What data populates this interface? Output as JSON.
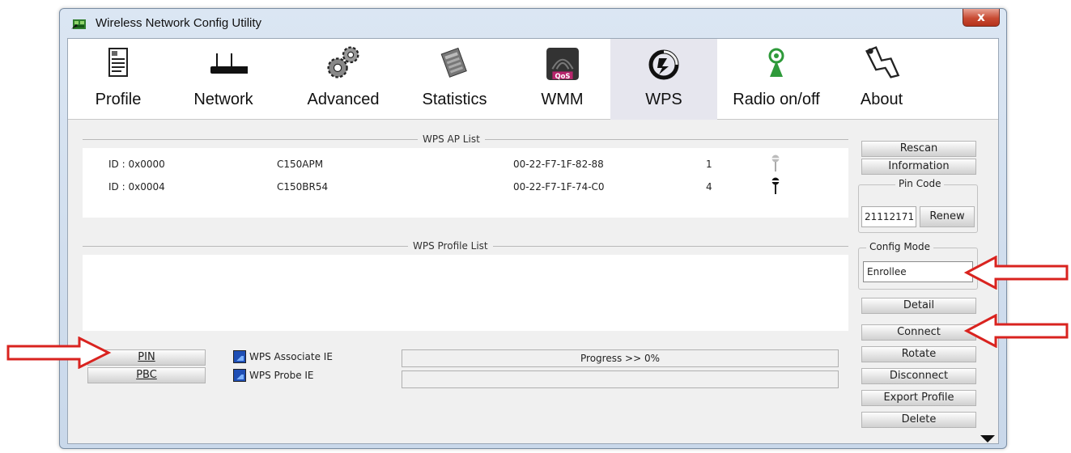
{
  "window": {
    "title": "Wireless Network Config Utility",
    "close_glyph": "x"
  },
  "toolbar": {
    "items": [
      {
        "label": "Profile",
        "icon": "profile-icon"
      },
      {
        "label": "Network",
        "icon": "network-icon"
      },
      {
        "label": "Advanced",
        "icon": "advanced-gears-icon"
      },
      {
        "label": "Statistics",
        "icon": "statistics-icon"
      },
      {
        "label": "WMM",
        "icon": "qos-wmm-icon"
      },
      {
        "label": "WPS",
        "icon": "wps-icon",
        "active": true
      },
      {
        "label": "Radio on/off",
        "icon": "radio-antenna-icon"
      },
      {
        "label": "About",
        "icon": "about-icon"
      }
    ]
  },
  "ap_list": {
    "caption": "WPS AP List",
    "rows": [
      {
        "id": "ID : 0x0000",
        "ssid": "C150APM",
        "bssid": "00-22-F7-1F-82-88",
        "channel": "1"
      },
      {
        "id": "ID : 0x0004",
        "ssid": "C150BR54",
        "bssid": "00-22-F7-1F-74-C0",
        "channel": "4"
      }
    ]
  },
  "profile_list": {
    "caption": "WPS Profile List"
  },
  "bottom": {
    "pin_label": "PIN",
    "pbc_label": "PBC",
    "associate_ie_label": "WPS Associate IE",
    "probe_ie_label": "WPS Probe IE",
    "progress_text": "Progress >> 0%"
  },
  "right_panel": {
    "rescan_label": "Rescan",
    "information_label": "Information",
    "pin_code_title": "Pin Code",
    "pin_code_value": "21112171",
    "renew_label": "Renew",
    "config_mode_title": "Config Mode",
    "config_mode_value": "Enrollee",
    "detail_label": "Detail",
    "connect_label": "Connect",
    "rotate_label": "Rotate",
    "disconnect_label": "Disconnect",
    "export_profile_label": "Export Profile",
    "delete_label": "Delete"
  },
  "colors": {
    "annotation_arrow": "#d9231f",
    "checkbox_fill": "#1f4fb5",
    "close_button": "#c84a32"
  }
}
